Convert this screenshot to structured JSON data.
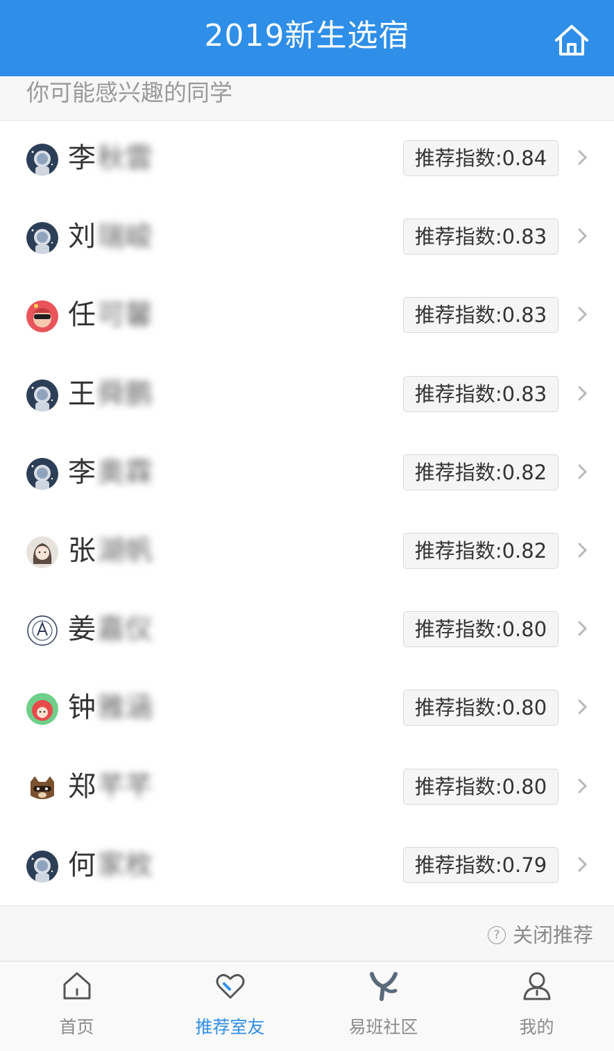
{
  "header": {
    "title": "2019新生选宿",
    "home_icon": "home-icon"
  },
  "section": {
    "label": "你可能感兴趣的同学"
  },
  "students": [
    {
      "surname": "李",
      "given": "秋雲",
      "score": "推荐指数:0.84",
      "avatar": "astronaut"
    },
    {
      "surname": "刘",
      "given": "瑞峻",
      "score": "推荐指数:0.83",
      "avatar": "astronaut"
    },
    {
      "surname": "任",
      "given": "可馨",
      "score": "推荐指数:0.83",
      "avatar": "sunglasses"
    },
    {
      "surname": "王",
      "given": "舜鹏",
      "score": "推荐指数:0.83",
      "avatar": "astronaut"
    },
    {
      "surname": "李",
      "given": "奥霖",
      "score": "推荐指数:0.82",
      "avatar": "astronaut"
    },
    {
      "surname": "张",
      "given": "湖帆",
      "score": "推荐指数:0.82",
      "avatar": "girl"
    },
    {
      "surname": "姜",
      "given": "嘉仪",
      "score": "推荐指数:0.80",
      "avatar": "emblem"
    },
    {
      "surname": "钟",
      "given": "雅涵",
      "score": "推荐指数:0.80",
      "avatar": "red-character"
    },
    {
      "surname": "郑",
      "given": "芊芊",
      "score": "推荐指数:0.80",
      "avatar": "raccoon"
    },
    {
      "surname": "何",
      "given": "家枚",
      "score": "推荐指数:0.79",
      "avatar": "astronaut"
    }
  ],
  "footer": {
    "close_label": "关闭推荐"
  },
  "tabs": [
    {
      "label": "首页",
      "icon": "home-icon",
      "active": false
    },
    {
      "label": "推荐室友",
      "icon": "heart-icon",
      "active": true
    },
    {
      "label": "易班社区",
      "icon": "yiban-icon",
      "active": false
    },
    {
      "label": "我的",
      "icon": "user-icon",
      "active": false
    }
  ],
  "colors": {
    "primary": "#2f8fe8",
    "text": "#333333",
    "muted": "#8a8a8a"
  }
}
